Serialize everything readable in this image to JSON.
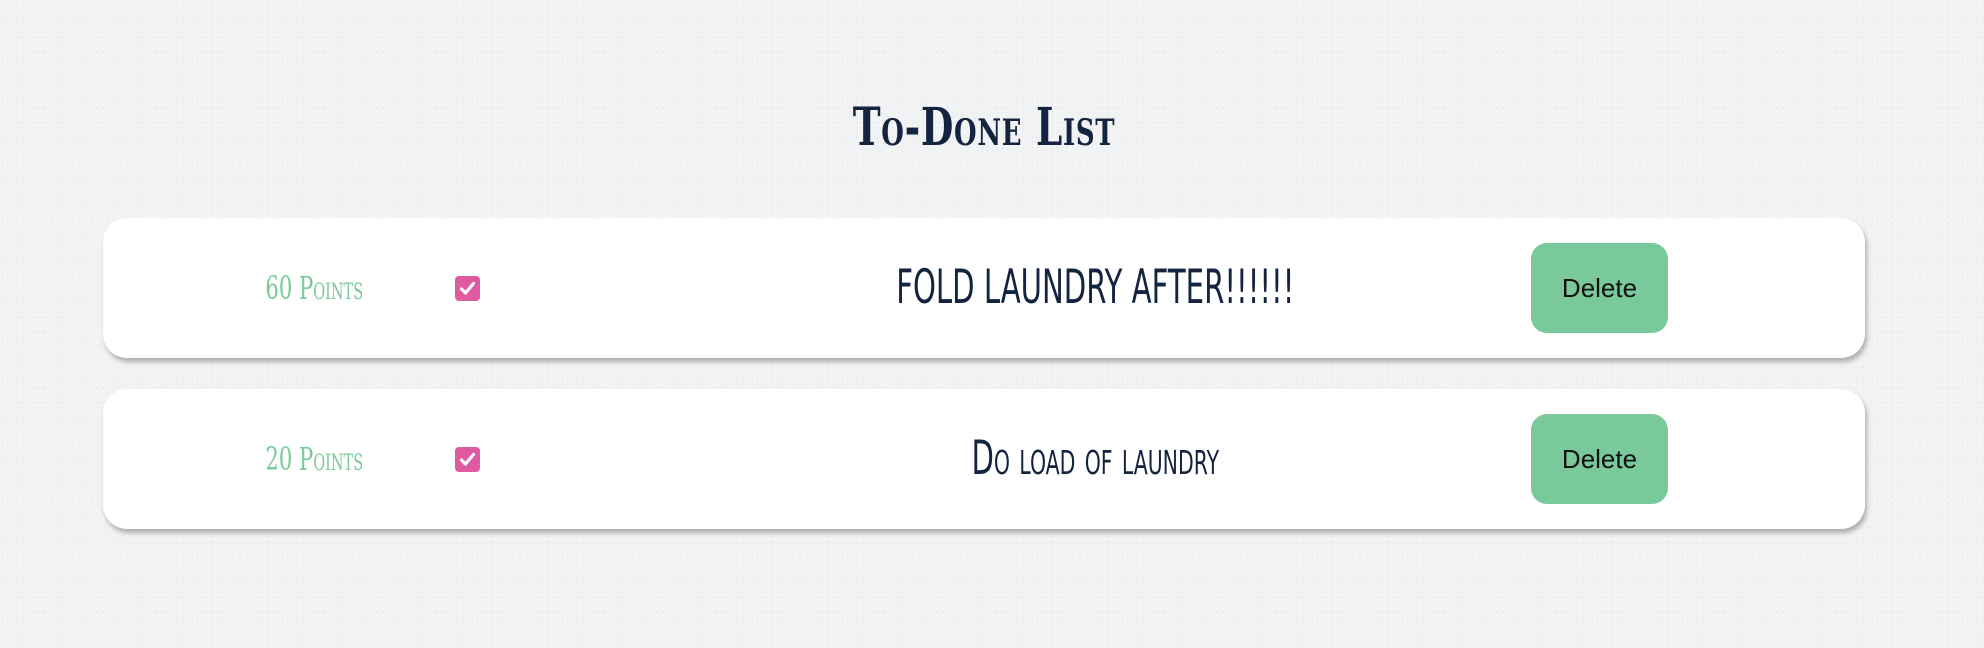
{
  "page": {
    "title": "To-Done List"
  },
  "colors": {
    "background": "#f1f2f4",
    "title_text": "#14233f",
    "points_text": "#79c99a",
    "checkbox_checked": "#df5aa0",
    "delete_button": "#79c99a"
  },
  "todos": [
    {
      "points_label": "60 Points",
      "completed": true,
      "checkbox_icon": "check-icon",
      "text": "FOLD LAUNDRY AFTER!!!!!!",
      "delete_label": "Delete"
    },
    {
      "points_label": "20 Points",
      "completed": true,
      "checkbox_icon": "check-icon",
      "text": "Do load of laundry",
      "delete_label": "Delete"
    }
  ]
}
